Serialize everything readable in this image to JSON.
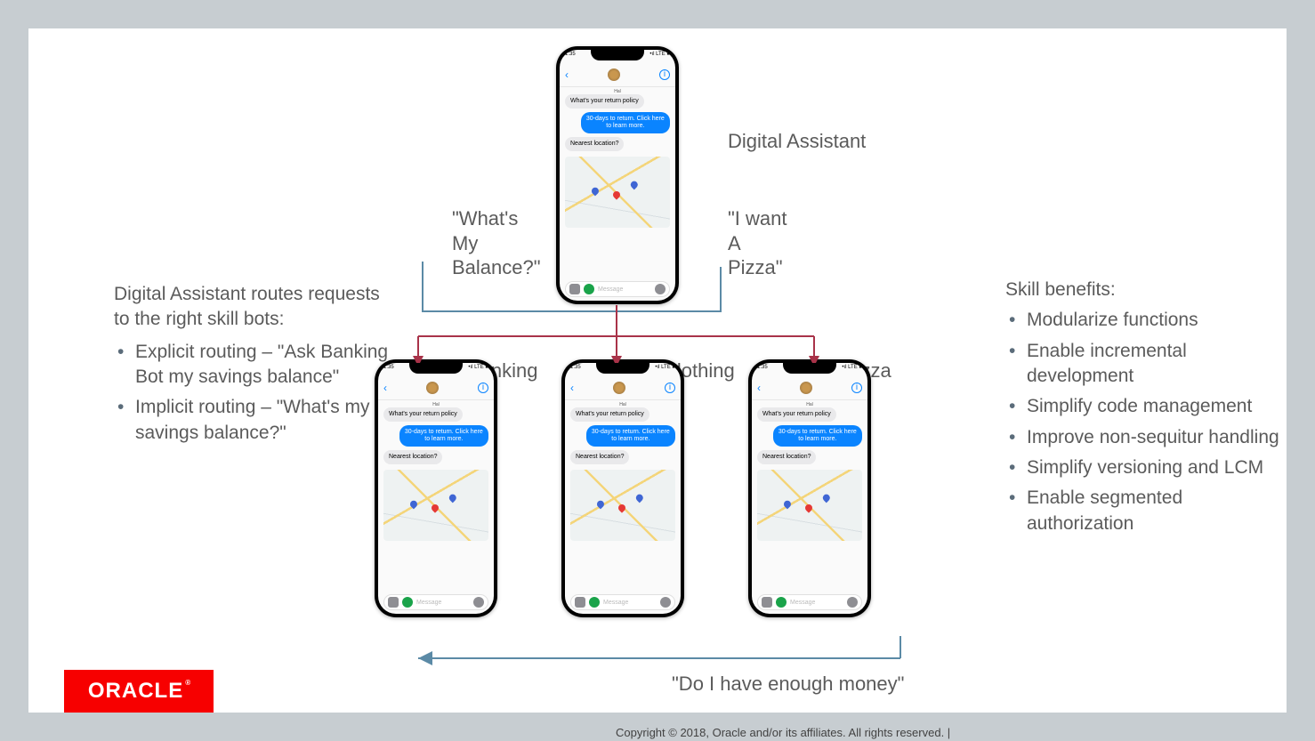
{
  "left": {
    "intro": "Digital Assistant routes requests to the right skill bots:",
    "items": [
      "Explicit routing – \"Ask Banking Bot my savings balance\"",
      "Implicit routing – \"What's my savings balance?\""
    ]
  },
  "right": {
    "intro": "Skill benefits:",
    "items": [
      "Modularize functions",
      "Enable incremental development",
      "Simplify code management",
      "Improve non-sequitur handling",
      "Simplify versioning and LCM",
      "Enable segmented authorization"
    ]
  },
  "labels": {
    "digital_assistant": "Digital Assistant",
    "balance": "\"What's\nMy\nBalance?\"",
    "pizza_want": "\"I want\nA\nPizza\"",
    "banking": "Banking",
    "clothing": "Clothing",
    "pizza": "Pizza",
    "bottom": "\"Do I have enough money\""
  },
  "phone": {
    "time": "1:35",
    "signal": "•ıl LTE ■",
    "name": "Hal",
    "msg1": "What's your return policy",
    "msg2": "30-days to return. Click here to learn more.",
    "msg3": "Nearest location?",
    "placeholder": "Message"
  },
  "logo": "ORACLE",
  "copyright": "Copyright © 2018, Oracle and/or its affiliates. All rights reserved.  |"
}
